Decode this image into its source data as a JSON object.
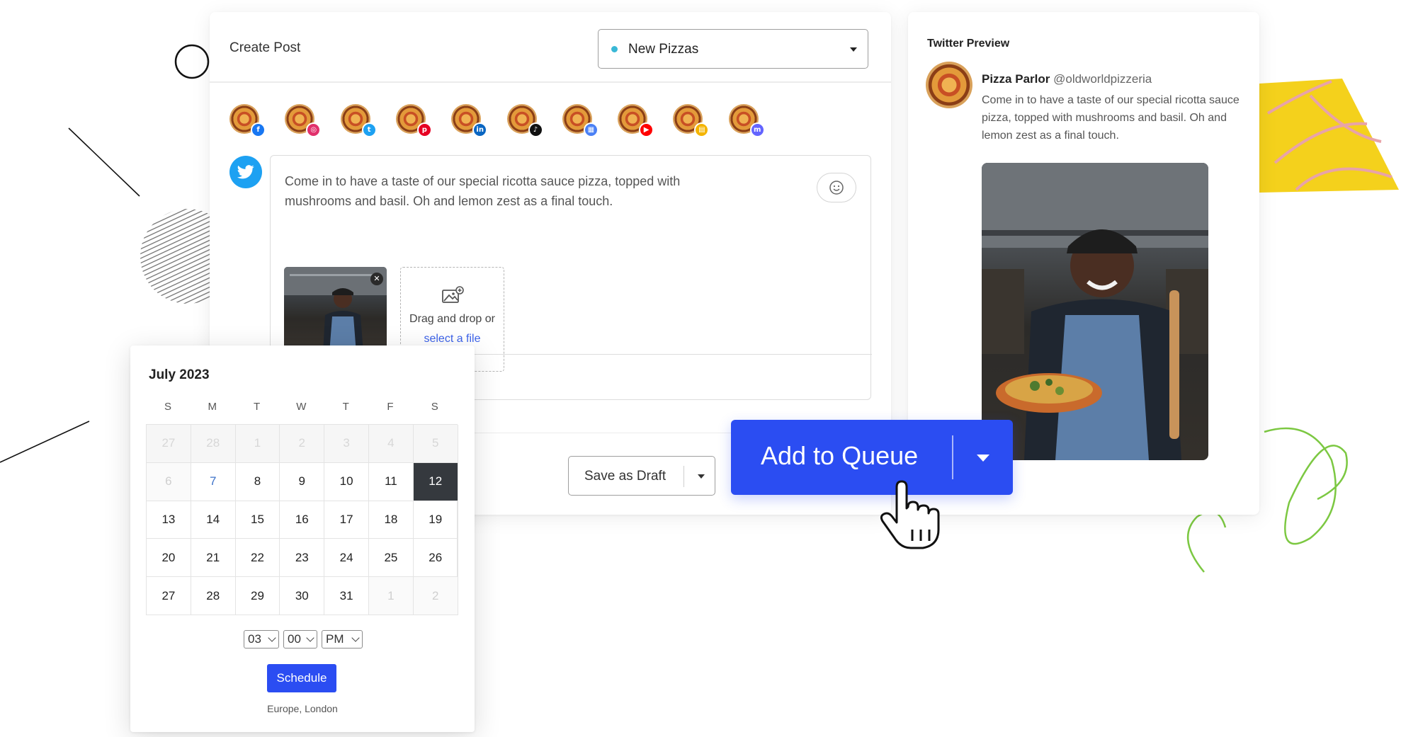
{
  "editor": {
    "title": "Create Post",
    "campaign": {
      "label": "New Pizzas",
      "dot_color": "#39b8d6"
    },
    "accounts": [
      {
        "network": "facebook",
        "icon": "facebook-icon",
        "color": "#1877f2",
        "glyph": "f"
      },
      {
        "network": "instagram",
        "icon": "instagram-icon",
        "color": "#e1306c",
        "glyph": "◎"
      },
      {
        "network": "twitter",
        "icon": "twitter-icon",
        "color": "#1da1f2",
        "glyph": "t"
      },
      {
        "network": "pinterest",
        "icon": "pinterest-icon",
        "color": "#e60023",
        "glyph": "p"
      },
      {
        "network": "linkedin",
        "icon": "linkedin-icon",
        "color": "#0a66c2",
        "glyph": "in"
      },
      {
        "network": "tiktok",
        "icon": "tiktok-icon",
        "color": "#111111",
        "glyph": "♪"
      },
      {
        "network": "google-business",
        "icon": "google-business-icon",
        "color": "#4a80f5",
        "glyph": "▦"
      },
      {
        "network": "youtube",
        "icon": "youtube-icon",
        "color": "#ff0000",
        "glyph": "▶"
      },
      {
        "network": "start-page",
        "icon": "start-page-icon",
        "color": "#f4b400",
        "glyph": "▤"
      },
      {
        "network": "mastodon",
        "icon": "mastodon-icon",
        "color": "#6364ff",
        "glyph": "m"
      }
    ],
    "post_text": "Come in to have a taste of our special ricotta sauce pizza, topped with mushrooms and basil. Oh and lemon zest as a final touch.",
    "dropzone": {
      "text": "Drag and drop or",
      "link": "select a file"
    },
    "save_draft_label": "Save as Draft"
  },
  "queue": {
    "label": "Add to Queue",
    "color": "#2b4df2"
  },
  "preview": {
    "title": "Twitter Preview",
    "name": "Pizza Parlor",
    "handle": "@oldworldpizzeria",
    "text": "Come in to have a taste of our special ricotta sauce pizza, topped with mushrooms and basil. Oh and lemon zest as a final touch."
  },
  "calendar": {
    "month": "July 2023",
    "weekdays": [
      "S",
      "M",
      "T",
      "W",
      "T",
      "F",
      "S"
    ],
    "weeks": [
      [
        "27",
        "28",
        "1",
        "2",
        "3",
        "4",
        "5"
      ],
      [
        "6",
        "7",
        "8",
        "9",
        "10",
        "11",
        "12"
      ],
      [
        "13",
        "14",
        "15",
        "16",
        "17",
        "18",
        "19"
      ],
      [
        "20",
        "21",
        "22",
        "23",
        "24",
        "25",
        "26"
      ],
      [
        "27",
        "28",
        "29",
        "30",
        "31",
        "1",
        "2"
      ]
    ],
    "disabled_row": 0,
    "disabled_cells": [
      [
        1,
        0
      ],
      [
        4,
        5
      ],
      [
        4,
        6
      ]
    ],
    "today_cell": [
      1,
      1
    ],
    "selected_cell": [
      1,
      6
    ],
    "hour": "03",
    "minute": "00",
    "meridiem": "PM",
    "schedule_label": "Schedule",
    "timezone": "Europe, London"
  }
}
